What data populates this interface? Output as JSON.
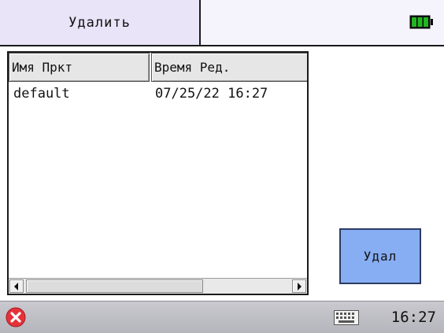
{
  "header": {
    "title": "Удалить",
    "battery_icon": "battery-full-icon",
    "battery_color": "#1faa1f"
  },
  "table": {
    "columns": [
      "Имя Пркт",
      "Время Ред."
    ],
    "rows": [
      {
        "name": "default",
        "modified": "07/25/22 16:27"
      }
    ]
  },
  "actions": {
    "delete_label": "Удал"
  },
  "taskbar": {
    "close_icon": "close-icon",
    "keyboard_icon": "keyboard-icon",
    "time": "16:27"
  }
}
